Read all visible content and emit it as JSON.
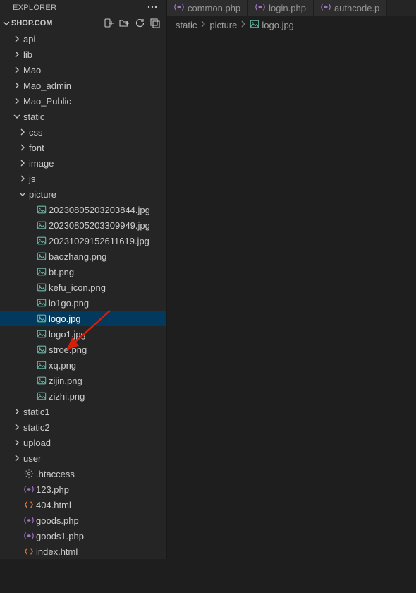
{
  "explorer": {
    "title": "EXPLORER",
    "project": "SHOP.COM"
  },
  "tree": [
    {
      "d": 1,
      "k": "folder",
      "exp": false,
      "name": "api"
    },
    {
      "d": 1,
      "k": "folder",
      "exp": false,
      "name": "lib"
    },
    {
      "d": 1,
      "k": "folder",
      "exp": false,
      "name": "Mao"
    },
    {
      "d": 1,
      "k": "folder",
      "exp": false,
      "name": "Mao_admin"
    },
    {
      "d": 1,
      "k": "folder",
      "exp": false,
      "name": "Mao_Public"
    },
    {
      "d": 1,
      "k": "folder",
      "exp": true,
      "name": "static"
    },
    {
      "d": 2,
      "k": "folder",
      "exp": false,
      "name": "css"
    },
    {
      "d": 2,
      "k": "folder",
      "exp": false,
      "name": "font"
    },
    {
      "d": 2,
      "k": "folder",
      "exp": false,
      "name": "image"
    },
    {
      "d": 2,
      "k": "folder",
      "exp": false,
      "name": "js"
    },
    {
      "d": 2,
      "k": "folder",
      "exp": true,
      "name": "picture"
    },
    {
      "d": 3,
      "k": "image",
      "name": "20230805203203844.jpg"
    },
    {
      "d": 3,
      "k": "image",
      "name": "20230805203309949.jpg"
    },
    {
      "d": 3,
      "k": "image",
      "name": "20231029152611619.jpg"
    },
    {
      "d": 3,
      "k": "image",
      "name": "baozhang.png"
    },
    {
      "d": 3,
      "k": "image",
      "name": "bt.png"
    },
    {
      "d": 3,
      "k": "image",
      "name": "kefu_icon.png"
    },
    {
      "d": 3,
      "k": "image",
      "name": "lo1go.png"
    },
    {
      "d": 3,
      "k": "image",
      "name": "logo.jpg",
      "selected": true
    },
    {
      "d": 3,
      "k": "image",
      "name": "logo1.jpg"
    },
    {
      "d": 3,
      "k": "image",
      "name": "stroe.png"
    },
    {
      "d": 3,
      "k": "image",
      "name": "xq.png"
    },
    {
      "d": 3,
      "k": "image",
      "name": "zijin.png"
    },
    {
      "d": 3,
      "k": "image",
      "name": "zizhi.png"
    },
    {
      "d": 1,
      "k": "folder",
      "exp": false,
      "name": "static1"
    },
    {
      "d": 1,
      "k": "folder",
      "exp": false,
      "name": "static2"
    },
    {
      "d": 1,
      "k": "folder",
      "exp": false,
      "name": "upload"
    },
    {
      "d": 1,
      "k": "folder",
      "exp": false,
      "name": "user"
    },
    {
      "d": 1,
      "k": "gear",
      "name": ".htaccess"
    },
    {
      "d": 1,
      "k": "php",
      "name": "123.php"
    },
    {
      "d": 1,
      "k": "html",
      "name": "404.html"
    },
    {
      "d": 1,
      "k": "php",
      "name": "goods.php"
    },
    {
      "d": 1,
      "k": "php",
      "name": "goods1.php"
    },
    {
      "d": 1,
      "k": "html",
      "name": "index.html"
    }
  ],
  "tabs": [
    {
      "icon": "php",
      "label": "common.php"
    },
    {
      "icon": "php",
      "label": "login.php"
    },
    {
      "icon": "php",
      "label": "authcode.p"
    }
  ],
  "breadcrumb": {
    "parts": [
      "static",
      "picture"
    ],
    "file": "logo.jpg"
  }
}
